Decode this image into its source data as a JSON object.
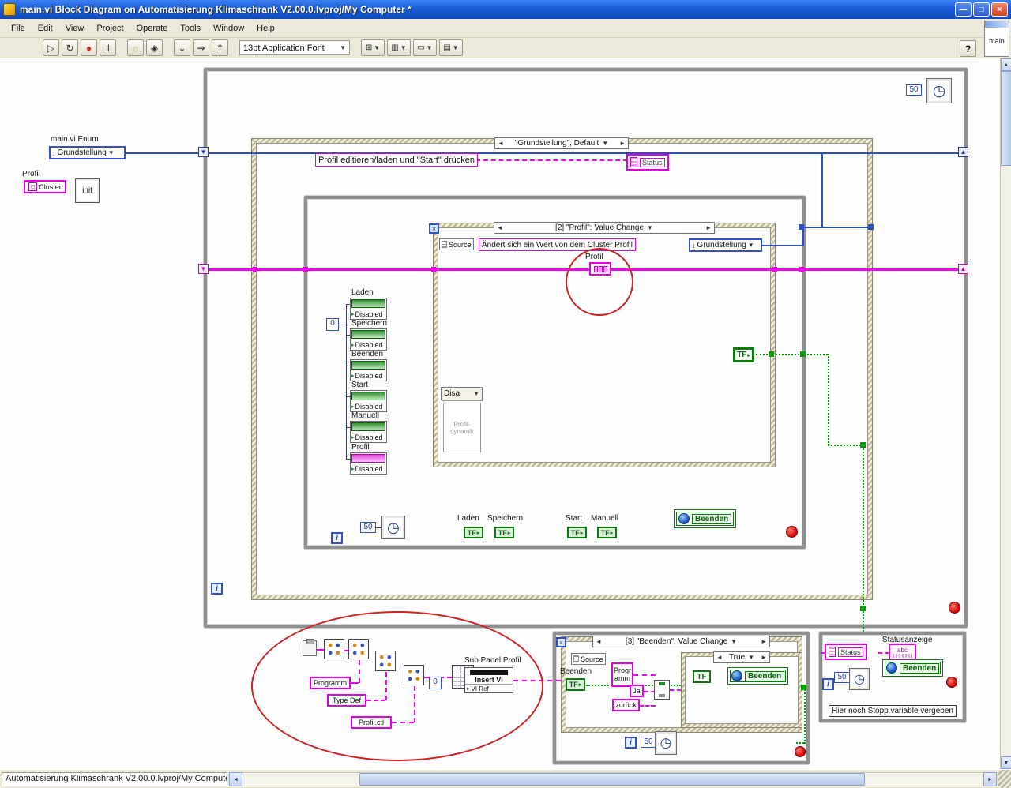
{
  "window": {
    "title": "main.vi Block Diagram on Automatisierung Klimaschrank V2.00.0.lvproj/My Computer *",
    "status_bar_text": "Automatisierung Klimaschrank V2.00.0.lvproj/My Computer",
    "main_badge": "main",
    "help_label": "?"
  },
  "menu": {
    "items": [
      {
        "label": "File"
      },
      {
        "label": "Edit"
      },
      {
        "label": "View"
      },
      {
        "label": "Project"
      },
      {
        "label": "Operate"
      },
      {
        "label": "Tools"
      },
      {
        "label": "Window"
      },
      {
        "label": "Help"
      }
    ]
  },
  "toolbar": {
    "font_selector": "13pt Application Font"
  },
  "icons": {
    "prev": "◄",
    "next": "►",
    "dropdown": "▼",
    "updown": "↕",
    "tf_arrow": "▸",
    "run": "▷",
    "run_cont": "↻",
    "abort": "●",
    "pause": "‖",
    "highlight": "☼",
    "retain": "◈",
    "step_into": "⇣",
    "step_over": "⇝",
    "step_out": "⇡",
    "align": "⊞",
    "distribute": "▥",
    "resize": "▭",
    "reorder": "▤",
    "clock": "◷",
    "timeout": "×",
    "minimize": "—",
    "restore": "□",
    "close": "×",
    "scroll_left": "◄",
    "scroll_right": "►",
    "scroll_up": "▲",
    "scroll_down": "▼",
    "sreg_down": "▼",
    "sreg_up": "▲"
  },
  "diagram": {
    "tf_label": "TF",
    "terminals": {
      "enum_label": "main.vi Enum",
      "enum_value": "Grundstellung",
      "profil_label": "Profil",
      "cluster_value": "Cluster",
      "init_label": "init"
    },
    "outer_loop": {
      "wait_value": "50",
      "iteration_label": "i"
    },
    "outer_event": {
      "header": "\"Grundstellung\", Default",
      "hint": "Profil editieren/laden und \"Start\" drücken",
      "status_label": "Status"
    },
    "inner_loop": {
      "zero_const": "0",
      "iteration_label": "i",
      "wait_value": "50",
      "beenden_button": "Beenden",
      "bool_terminals": [
        {
          "label": "Laden"
        },
        {
          "label": "Speichern"
        },
        {
          "label": "Start"
        },
        {
          "label": "Manuell"
        }
      ],
      "property_nodes": [
        {
          "name": "Laden",
          "value": "Disabled"
        },
        {
          "name": "Speichern",
          "value": "Disabled"
        },
        {
          "name": "Beenden",
          "value": "Disabled"
        },
        {
          "name": "Start",
          "value": "Disabled"
        },
        {
          "name": "Manuell",
          "value": "Disabled"
        },
        {
          "name": "Profil",
          "value": "Disabled"
        }
      ]
    },
    "inner_event": {
      "header": "[2] \"Profil\": Value Change",
      "source_label": "Source",
      "description": "Ändert sich ein Wert von dem Cluster Profil",
      "enum_value": "Grundstellung",
      "profil_label": "Profil",
      "disa_dropdown": "Disa",
      "profil_dynamik": "Profil-dynamik"
    },
    "subpanel_group": {
      "programm": "Programm",
      "type_def": "Type Def",
      "profil_ctl": "Profil.ctl",
      "sub_panel_label": "Sub Panel Profil",
      "insert_vi": "Insert VI",
      "vi_ref": "VI Ref",
      "zero_const": "0"
    },
    "beenden_event": {
      "header": "[3] \"Beenden\": Value Change",
      "source_label": "Source",
      "beenden_label": "Beenden",
      "string_programm": "Programm",
      "ja": "Ja",
      "zurueck": "zurück",
      "case_header": "True",
      "beenden_button": "Beenden",
      "iteration_label": "i",
      "wait_value": "50"
    },
    "status_loop": {
      "title": "Statusanzeige",
      "status_label": "Status",
      "abc_label": "abc",
      "beenden_button": "Beenden",
      "wait_value": "50",
      "iteration_label": "i",
      "note": "Hier noch Stopp variable vergeben"
    }
  }
}
